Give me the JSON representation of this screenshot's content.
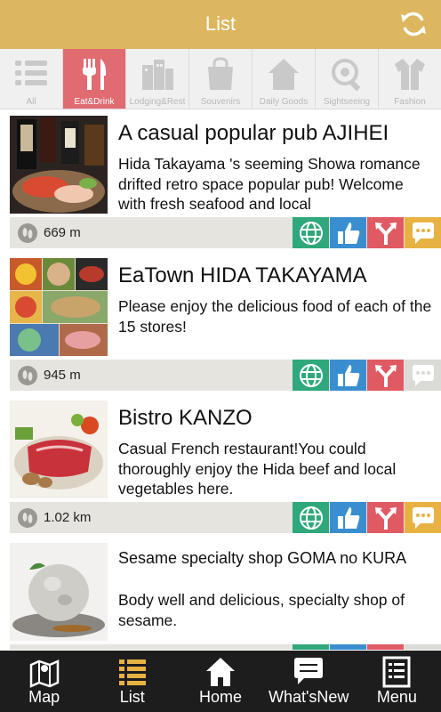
{
  "header": {
    "title": "List",
    "refresh_icon": "refresh-icon"
  },
  "categories": [
    {
      "label": "All",
      "icon": "list-icon",
      "active": false
    },
    {
      "label": "Eat&Drink",
      "icon": "fork-knife-icon",
      "active": true
    },
    {
      "label": "Lodging&Rest",
      "icon": "building-icon",
      "active": false
    },
    {
      "label": "Souvenirs",
      "icon": "shopping-bag-icon",
      "active": false
    },
    {
      "label": "Daily Goods",
      "icon": "house-icon",
      "active": false
    },
    {
      "label": "Sightseeing",
      "icon": "eye-icon",
      "active": false
    },
    {
      "label": "Fashion",
      "icon": "shirt-icon",
      "active": false
    }
  ],
  "items": [
    {
      "name": "A casual popular pub AJIHEI",
      "desc": "Hida Takayama 's seeming Showa romance drifted retro space popular pub! Welcome with fresh seafood and local",
      "distance": "669 m"
    },
    {
      "name": "EaTown HIDA TAKAYAMA",
      "desc": "Please enjoy the delicious food of each of the 15 stores!",
      "distance": "945 m"
    },
    {
      "name": "Bistro KANZO",
      "desc": "Casual French restaurant!You could thoroughly enjoy the Hida beef and local vegetables here.",
      "distance": "1.02 km"
    },
    {
      "name": "Sesame specialty shop GOMA no KURA",
      "desc": "Body well and delicious, specialty shop of sesame.",
      "distance": ""
    }
  ],
  "tabs": [
    {
      "label": "Map",
      "icon": "map-icon"
    },
    {
      "label": "List",
      "icon": "list-icon"
    },
    {
      "label": "Home",
      "icon": "home-icon"
    },
    {
      "label": "What'sNew",
      "icon": "chat-icon"
    },
    {
      "label": "Menu",
      "icon": "menu-icon"
    }
  ],
  "colors": {
    "header": "#ddb660",
    "active_category": "#e06c72",
    "web": "#2fa87b",
    "like": "#3a8ed0",
    "route": "#e05a63",
    "chat": "#e8b242",
    "tab_active": "#e8b242"
  }
}
